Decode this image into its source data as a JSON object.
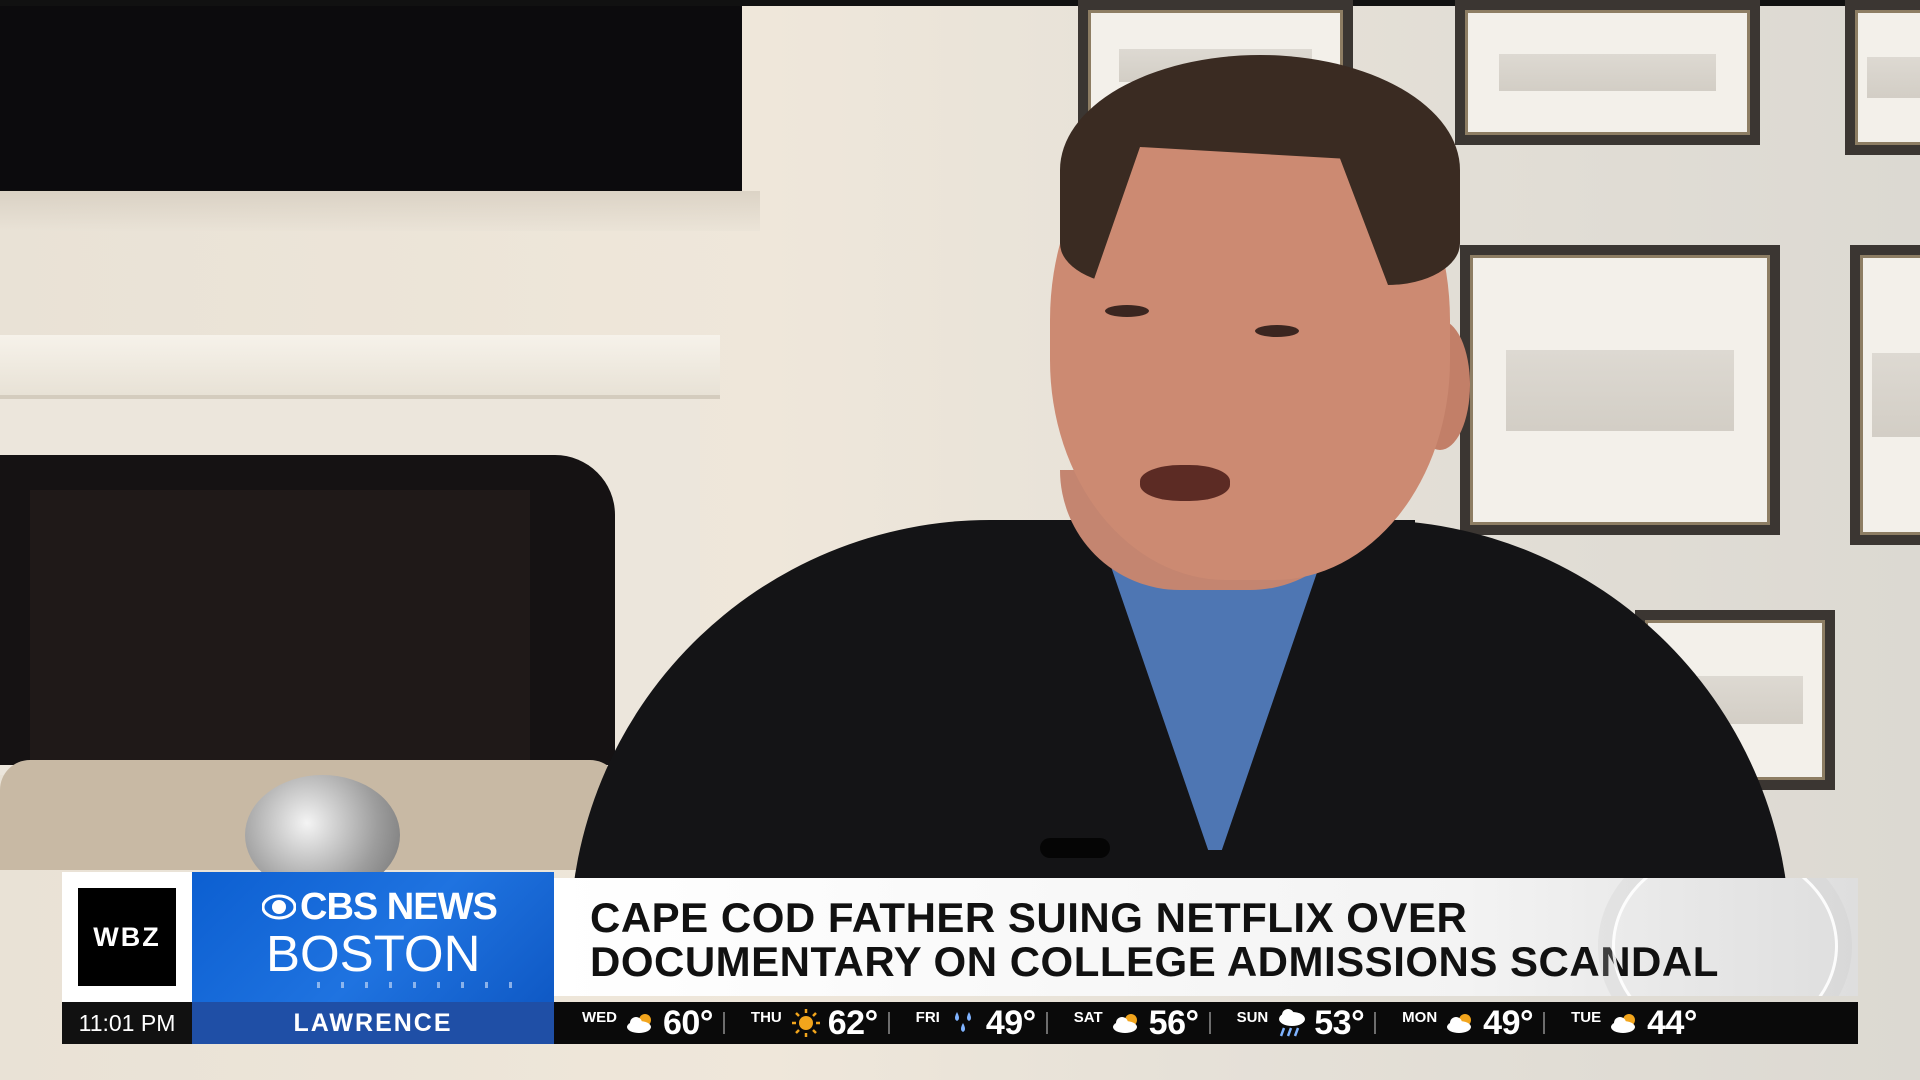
{
  "lower_third": {
    "station_logo": "WBZ",
    "brand_line1": "CBS NEWS",
    "brand_line2": "BOSTON",
    "headline_line1": "CAPE COD FATHER SUING NETFLIX OVER",
    "headline_line2": "DOCUMENTARY ON COLLEGE ADMISSIONS SCANDAL",
    "time": "11:01 PM",
    "location": "LAWRENCE"
  },
  "weather": [
    {
      "day": "WED",
      "icon": "partly-cloudy-icon",
      "temp": "60°"
    },
    {
      "day": "THU",
      "icon": "sunny-icon",
      "temp": "62°"
    },
    {
      "day": "FRI",
      "icon": "rain-icon",
      "temp": "49°"
    },
    {
      "day": "SAT",
      "icon": "partly-cloudy-icon",
      "temp": "56°"
    },
    {
      "day": "SUN",
      "icon": "showers-icon",
      "temp": "53°"
    },
    {
      "day": "MON",
      "icon": "partly-cloudy-icon",
      "temp": "49°"
    },
    {
      "day": "TUE",
      "icon": "partly-cloudy-icon",
      "temp": "44°"
    }
  ],
  "colors": {
    "brand_blue": "#1f73e0",
    "location_blue": "#1f4fa6",
    "sun_yellow": "#f2a51c",
    "rain_blue": "#7fb3ff"
  }
}
